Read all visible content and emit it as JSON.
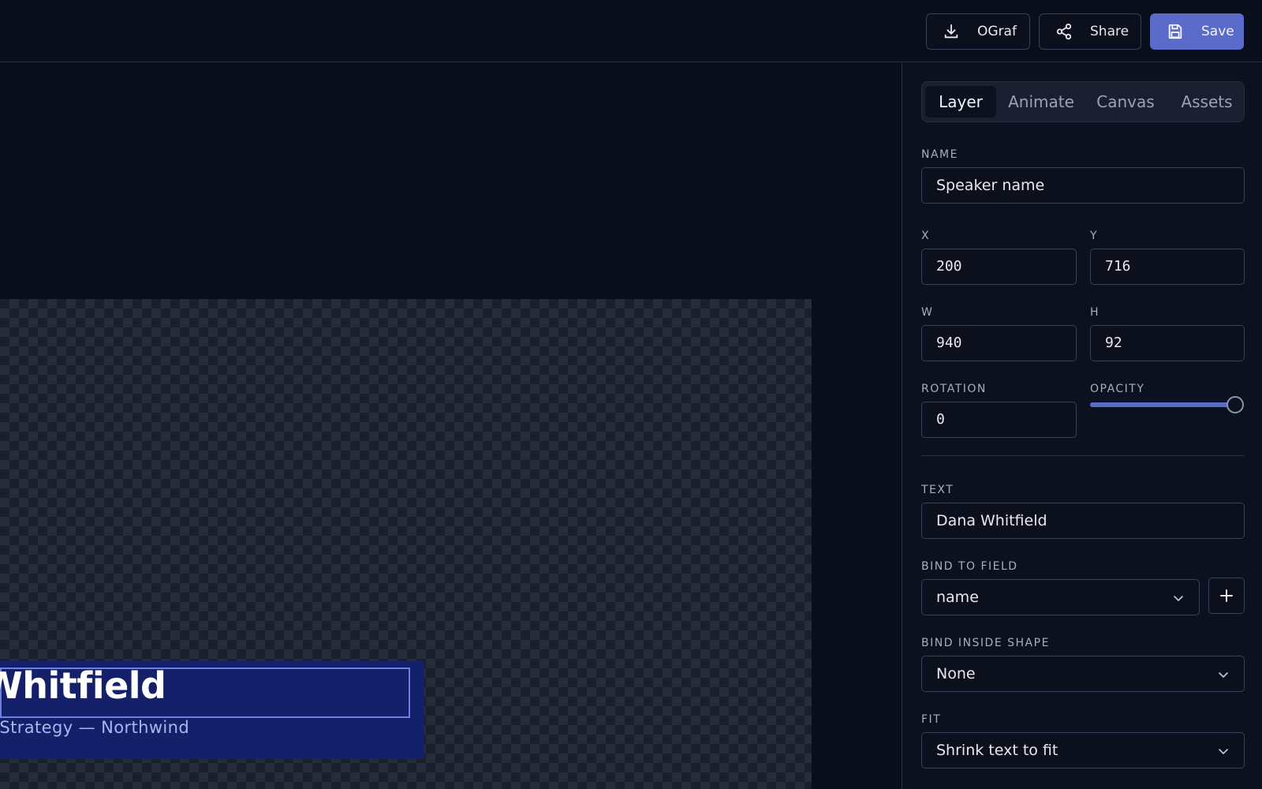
{
  "toolbar": {
    "ograf_label": "OGraf",
    "share_label": "Share",
    "save_label": "Save",
    "icons": {
      "ograf": "download-icon",
      "share": "share-icon",
      "save": "floppy-disk-icon"
    }
  },
  "canvas": {
    "lower_third": {
      "name": "a Whitfield",
      "title": "uct Strategy — Northwind"
    }
  },
  "panel": {
    "tabs": [
      {
        "label": "Layer",
        "active": true
      },
      {
        "label": "Animate",
        "active": false
      },
      {
        "label": "Canvas",
        "active": false
      },
      {
        "label": "Assets",
        "active": false
      }
    ],
    "name": {
      "label": "NAME",
      "value": "Speaker name"
    },
    "x": {
      "label": "X",
      "value": "200"
    },
    "y": {
      "label": "Y",
      "value": "716"
    },
    "w": {
      "label": "W",
      "value": "940"
    },
    "h": {
      "label": "H",
      "value": "92"
    },
    "rotation": {
      "label": "ROTATION",
      "value": "0"
    },
    "opacity": {
      "label": "OPACITY",
      "value": 1.0
    },
    "text": {
      "label": "TEXT",
      "value": "Dana Whitfield"
    },
    "bind_field": {
      "label": "BIND TO FIELD",
      "value": "name"
    },
    "bind_shape": {
      "label": "BIND INSIDE SHAPE",
      "value": "None"
    },
    "fit": {
      "label": "FIT",
      "value": "Shrink text to fit"
    }
  },
  "colors": {
    "accent": "#5b6bc9",
    "background": "#0a0e1a",
    "lower_third_bg": "#14216a"
  }
}
